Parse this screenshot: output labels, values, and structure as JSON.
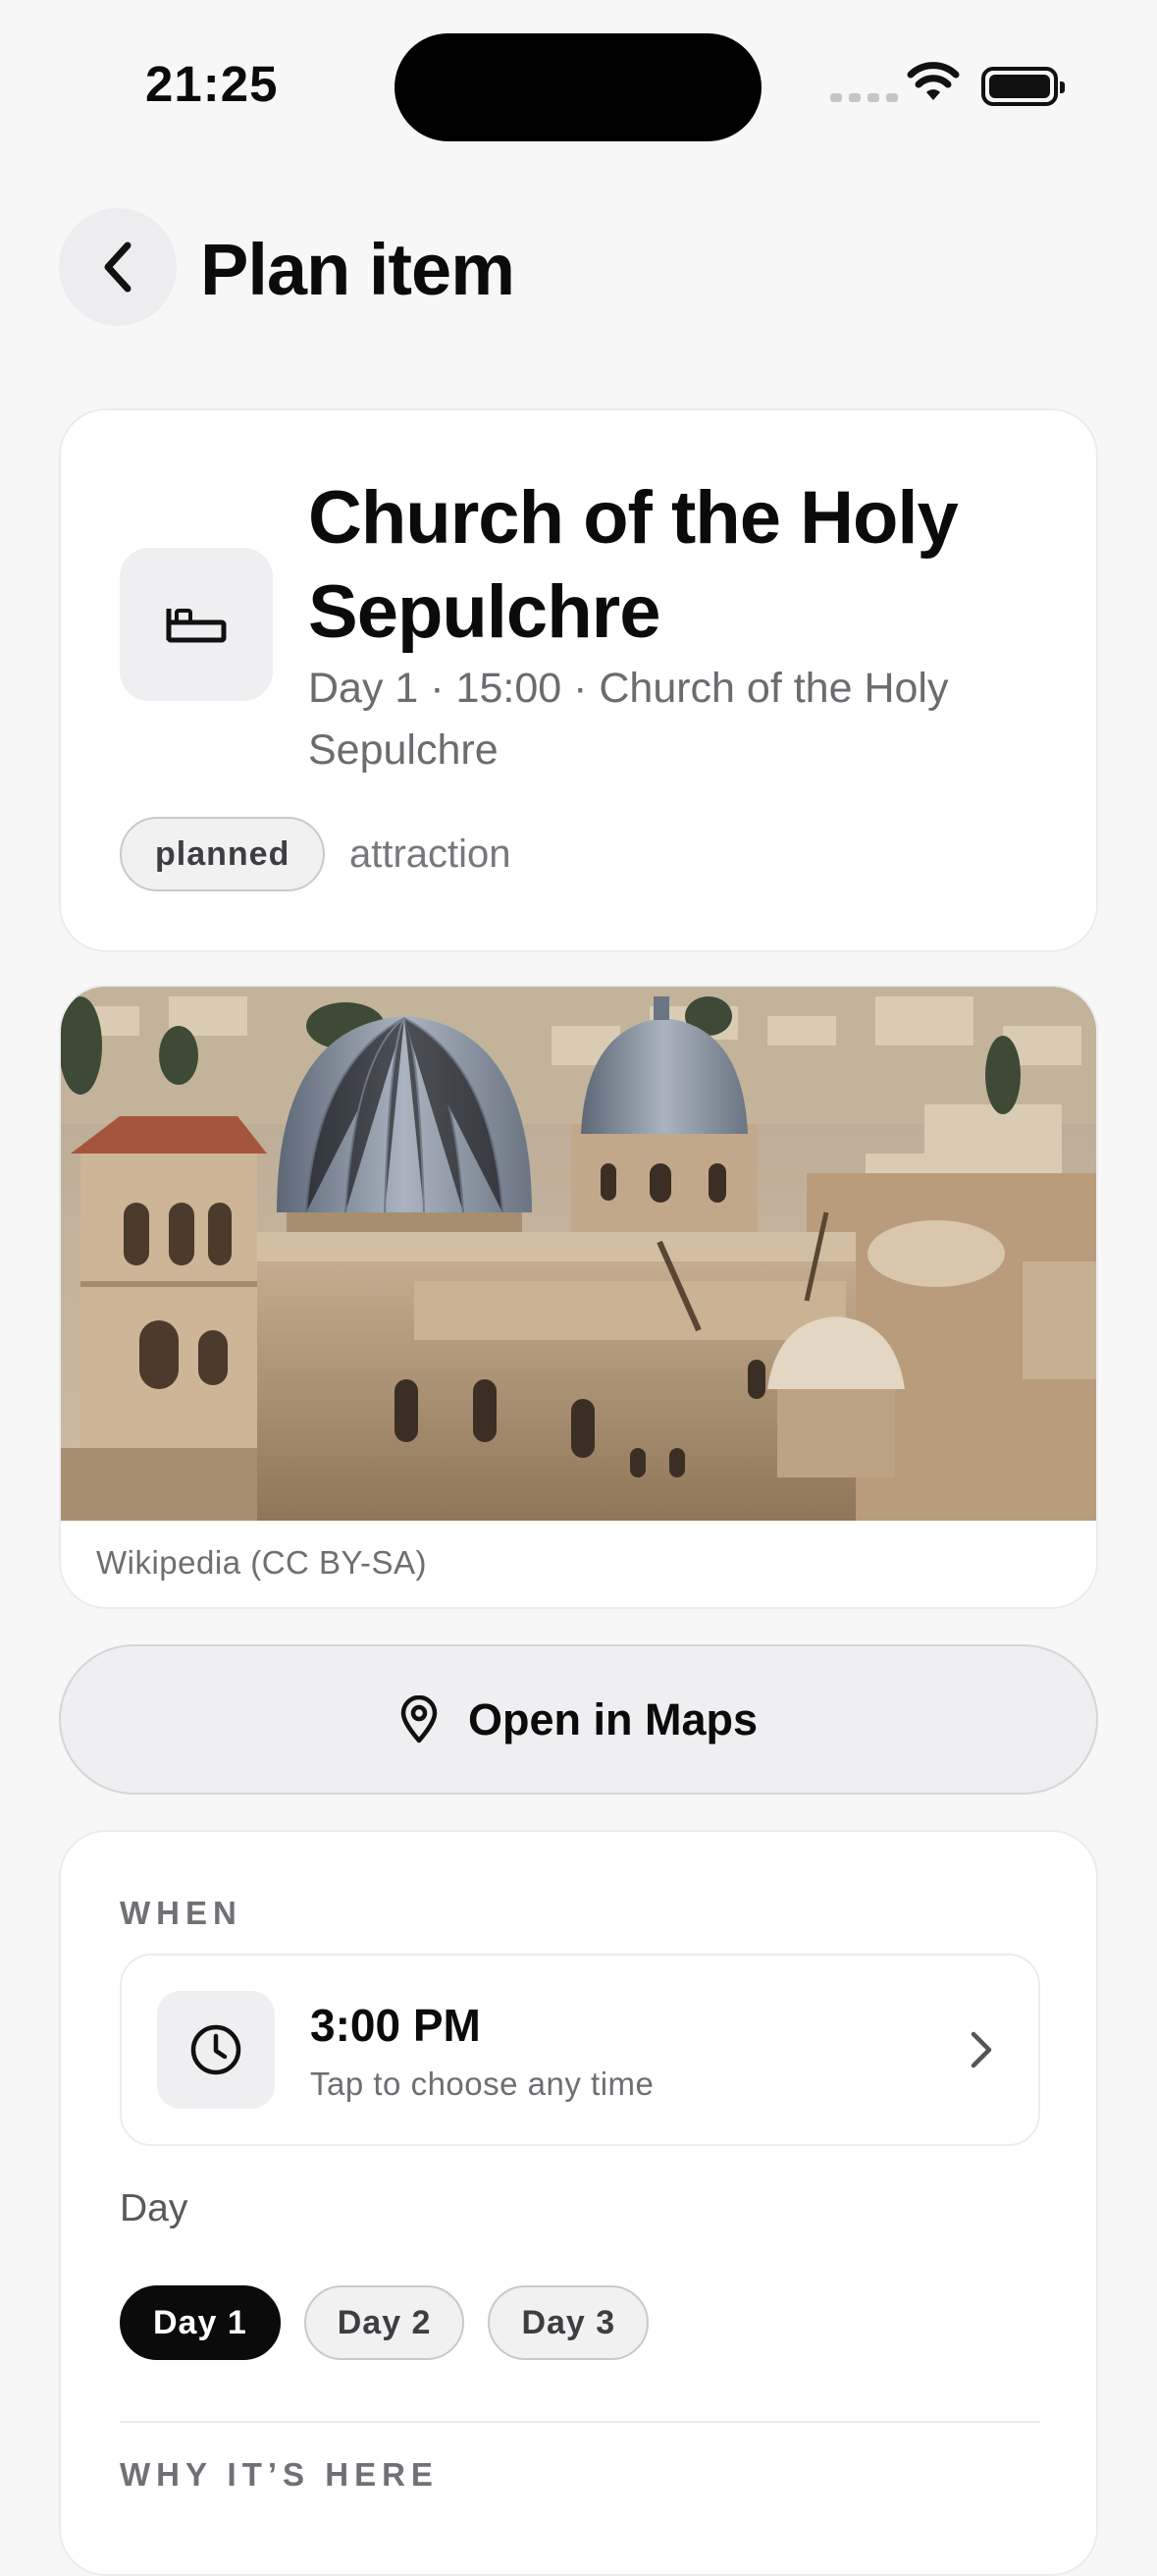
{
  "status": {
    "time": "21:25"
  },
  "nav": {
    "title": "Plan item"
  },
  "hero": {
    "title": "Church of the Holy Sepulchre",
    "subtitle": "Day 1 · 15:00 · Church of the Holy Sepulchre",
    "status_pill": "planned",
    "category": "attraction",
    "icon": "bed-icon"
  },
  "photo": {
    "credit": "Wikipedia (CC BY-SA)"
  },
  "maps": {
    "label": "Open in Maps",
    "icon": "map-pin-icon"
  },
  "when": {
    "section_label": "WHEN",
    "time_value": "3:00 PM",
    "time_hint": "Tap to choose any time",
    "day_label": "Day",
    "days": [
      "Day 1",
      "Day 2",
      "Day 3"
    ],
    "selected_day": "Day 1"
  },
  "why": {
    "section_label": "WHY IT’S HERE"
  },
  "colors": {
    "accent": "#0b0b0c",
    "background": "#f7f7f8",
    "card": "#ffffff",
    "muted": "#6b6b70"
  }
}
